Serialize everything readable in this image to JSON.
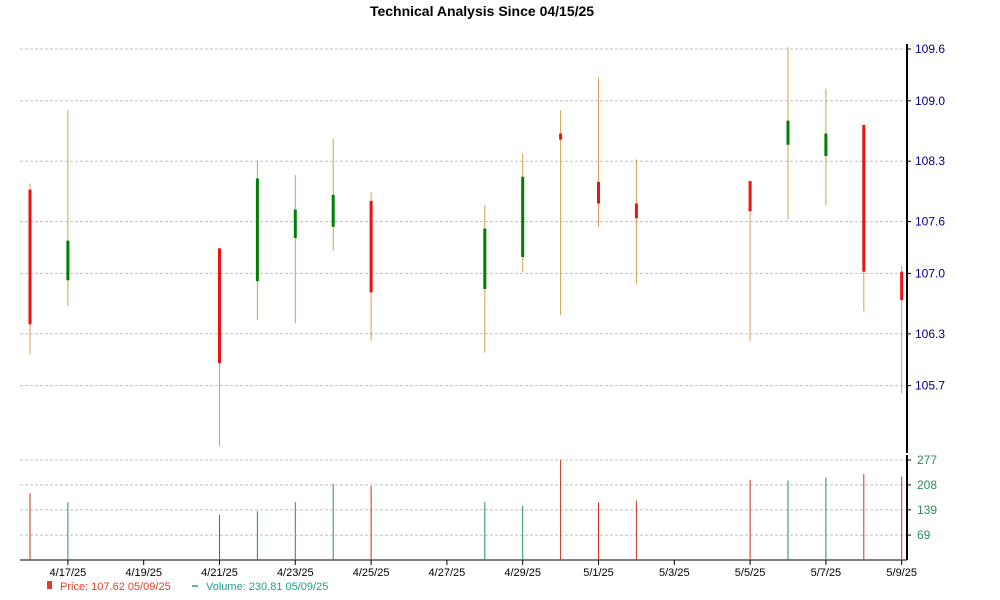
{
  "chart_data": {
    "type": "candlestick",
    "title": "Technical Analysis Since 04/15/25",
    "price_ticks": [
      105.7,
      106.3,
      107.0,
      107.6,
      108.3,
      109.0,
      109.6
    ],
    "price_ylim": [
      105.0,
      109.6
    ],
    "volume_ticks": [
      69,
      139,
      208,
      277
    ],
    "volume_ylim": [
      0,
      277
    ],
    "x_range": [
      "2025-04-16",
      "2025-05-09"
    ],
    "x_ticks": [
      "4/17/25",
      "4/19/25",
      "4/21/25",
      "4/23/25",
      "4/25/25",
      "4/27/25",
      "4/29/25",
      "5/1/25",
      "5/3/25",
      "5/5/25",
      "5/7/25",
      "5/9/25"
    ],
    "candles": [
      {
        "date": "2025-04-16",
        "open": 107.97,
        "close": 106.41,
        "high": 108.04,
        "low": 106.06,
        "volume": 185
      },
      {
        "date": "2025-04-17",
        "open": 106.92,
        "close": 107.38,
        "high": 108.89,
        "low": 106.62,
        "volume": 160
      },
      {
        "date": "2025-04-21",
        "open": 107.29,
        "close": 105.96,
        "high": 107.29,
        "low": 105.0,
        "volume": 125
      },
      {
        "date": "2025-04-22",
        "open": 106.91,
        "close": 108.1,
        "high": 108.31,
        "low": 106.46,
        "volume": 135
      },
      {
        "date": "2025-04-23",
        "open": 107.41,
        "close": 107.74,
        "high": 108.14,
        "low": 106.42,
        "volume": 160
      },
      {
        "date": "2025-04-24",
        "open": 107.54,
        "close": 107.91,
        "high": 108.56,
        "low": 107.26,
        "volume": 210
      },
      {
        "date": "2025-04-25",
        "open": 107.84,
        "close": 106.78,
        "high": 107.94,
        "low": 106.22,
        "volume": 205
      },
      {
        "date": "2025-04-28",
        "open": 106.82,
        "close": 107.52,
        "high": 107.79,
        "low": 106.08,
        "volume": 160
      },
      {
        "date": "2025-04-29",
        "open": 107.19,
        "close": 108.12,
        "high": 108.39,
        "low": 107.02,
        "volume": 150
      },
      {
        "date": "2025-04-30",
        "open": 108.62,
        "close": 108.55,
        "high": 108.89,
        "low": 106.52,
        "volume": 277
      },
      {
        "date": "2025-05-01",
        "open": 108.06,
        "close": 107.81,
        "high": 109.27,
        "low": 107.54,
        "volume": 160
      },
      {
        "date": "2025-05-02",
        "open": 107.81,
        "close": 107.64,
        "high": 108.32,
        "low": 106.87,
        "volume": 165
      },
      {
        "date": "2025-05-05",
        "open": 108.07,
        "close": 107.72,
        "high": 107.72,
        "low": 106.22,
        "volume": 222
      },
      {
        "date": "2025-05-06",
        "open": 108.49,
        "close": 108.77,
        "high": 109.62,
        "low": 107.63,
        "volume": 220
      },
      {
        "date": "2025-05-07",
        "open": 108.36,
        "close": 108.62,
        "high": 109.14,
        "low": 107.79,
        "volume": 228
      },
      {
        "date": "2025-05-08",
        "open": 108.72,
        "close": 107.02,
        "high": 108.72,
        "low": 106.56,
        "volume": 238
      },
      {
        "date": "2025-05-09",
        "open": 107.02,
        "close": 106.69,
        "high": 107.09,
        "low": 105.61,
        "volume": 230.81
      }
    ],
    "colors": {
      "up": "#008000",
      "down": "#ee1111",
      "wick": "#d4a050",
      "volume_up": "#2e8b57",
      "volume_down": "#cc3322",
      "grid": "#c0c0c0",
      "price_axis": "#00008b",
      "volume_axis": "#2e8b57"
    },
    "grid": true,
    "legend": {
      "price": "Price: 107.62  05/09/25",
      "volume": "Volume: 230.81  05/09/25"
    }
  }
}
